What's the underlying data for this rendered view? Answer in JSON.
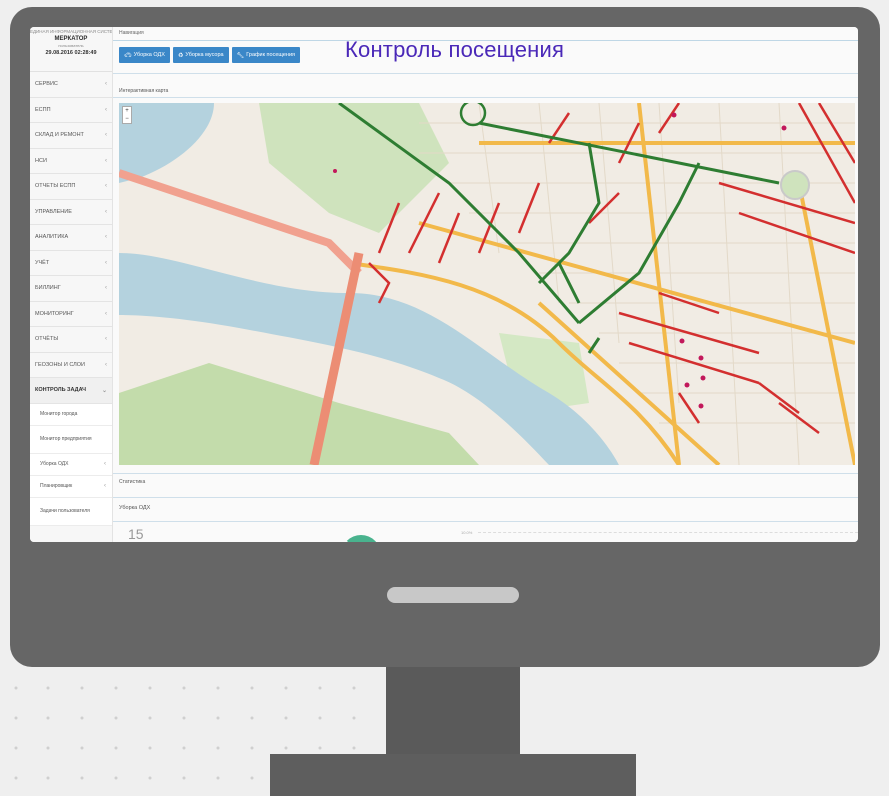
{
  "sidebar": {
    "org": "ЕДИНАЯ ИНФОРМАЦИОННАЯ СИСТЕМА",
    "brand": "МЕРКАТОР",
    "user": "пользователь",
    "datetime": "29.08.2016 02:28:49",
    "items": [
      {
        "label": "СЕРВИС"
      },
      {
        "label": "ЕСПП"
      },
      {
        "label": "СКЛАД И РЕМОНТ"
      },
      {
        "label": "НСИ"
      },
      {
        "label": "ОТЧЕТЫ ЕСПП"
      },
      {
        "label": "УПРАВЛЕНИЕ"
      },
      {
        "label": "АНАЛИТИКА"
      },
      {
        "label": "УЧЁТ"
      },
      {
        "label": "БИЛЛИНГ"
      },
      {
        "label": "МОНИТОРИНГ"
      },
      {
        "label": "ОТЧЁТЫ"
      },
      {
        "label": "ГЕОЗОНЫ И СЛОИ"
      },
      {
        "label": "КОНТРОЛЬ ЗАДАЧ"
      }
    ],
    "subitems": [
      {
        "label": "Монитор города"
      },
      {
        "label": "Монитор предприятия"
      },
      {
        "label": "Уборка ОДХ"
      },
      {
        "label": "Планировщик"
      },
      {
        "label": "Задачи пользователя"
      }
    ]
  },
  "main": {
    "nav_label": "Навигация",
    "buttons": [
      {
        "label": "Уборка ОДХ",
        "icon": "car-icon"
      },
      {
        "label": "Уборка мусора",
        "icon": "trash-icon"
      },
      {
        "label": "График посещения",
        "icon": "wrench-icon"
      }
    ],
    "title": "Контроль посещения",
    "map_label": "Интерактивная карта",
    "stats_label": "Статистика",
    "stats_sub": "Уборка ОДХ",
    "stats_value": "15",
    "axis_tick": "10.0%"
  },
  "colors": {
    "accent": "#3a87c8",
    "title": "#4a28b8",
    "route_visited": "#2e7d32",
    "route_pending": "#d32f2f",
    "road_major": "#f2b94a",
    "river": "#b4d2de",
    "park": "#c8deb0"
  }
}
